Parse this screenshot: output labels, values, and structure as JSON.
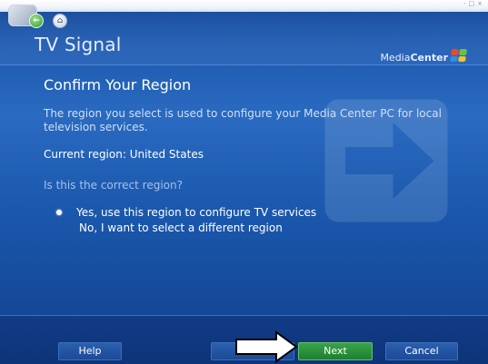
{
  "window": {
    "title": "TV Signal",
    "brand_prefix": "Media",
    "brand_suffix": "Center",
    "controls": [
      "-",
      "□",
      "×"
    ]
  },
  "nav": {
    "back_icon": "back-arrow-icon",
    "home_icon": "home-icon"
  },
  "page": {
    "heading": "Confirm Your Region",
    "description": "The region you select is used to configure your Media Center PC for local television services.",
    "current_region": "Current region: United States",
    "question": "Is this the correct region?",
    "options": [
      {
        "label": "Yes, use this region to configure TV services",
        "selected": true
      },
      {
        "label": "No, I want to select a different region",
        "selected": false
      }
    ]
  },
  "footer": {
    "help": "Help",
    "next": "Next",
    "cancel": "Cancel"
  },
  "colors": {
    "background": "#1f5db2",
    "next_button": "#2f9a3a",
    "header_text": "#e6eefb"
  }
}
